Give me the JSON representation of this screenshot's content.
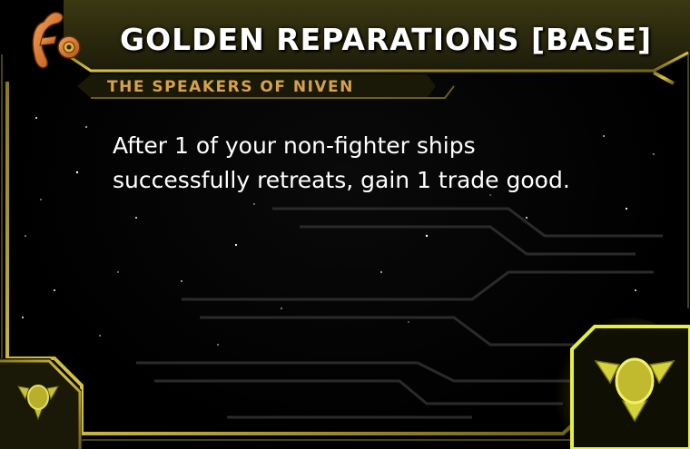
{
  "card": {
    "title": "GOLDEN REPARATIONS [BASE]",
    "faction": "THE SPEAKERS OF NIVEN",
    "ability_lines": [
      "After 1 of your non-fighter ships",
      "successfully retreats, gain 1 trade good."
    ]
  },
  "icons": {
    "faction_logo": "speakers-of-niven-logo",
    "left_corner": "faction-emblem",
    "right_corner": "glowing-faction-emblem"
  },
  "colors": {
    "frame_gold": "#b8a12a",
    "frame_dark": "#2c2a10",
    "faction_text": "#d6a24a",
    "title_text": "#ffffff",
    "emblem_glow": "#e6f03c",
    "logo_orange": "#e07a2a"
  }
}
